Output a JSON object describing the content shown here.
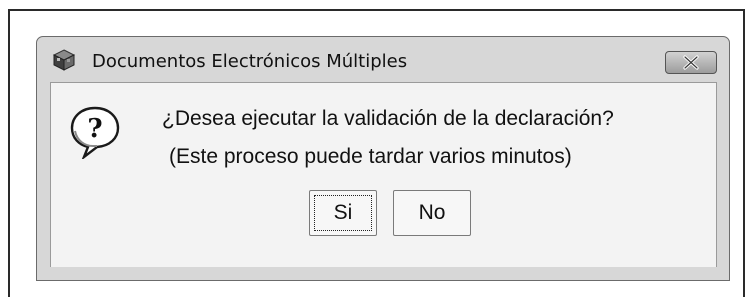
{
  "dialog": {
    "title": "Documentos Electrónicos Múltiples",
    "icon": "question-icon",
    "message_line1": "¿Desea ejecutar la validación de la declaración?",
    "message_line2": "(Este proceso puede tardar varios minutos)",
    "buttons": {
      "yes_label": "Si",
      "no_label": "No"
    },
    "focused_button": "Si"
  },
  "titlebar": {
    "app_icon": "app-cube-icon",
    "close_icon": "close-icon"
  },
  "colors": {
    "window_frame": "#d7d7d7",
    "client_background": "#f3f3f3",
    "text": "#111111"
  }
}
